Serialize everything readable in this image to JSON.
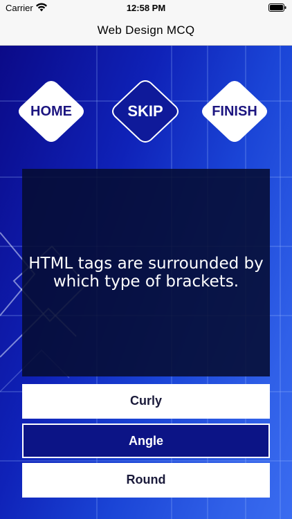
{
  "status_bar": {
    "carrier": "Carrier",
    "time": "12:58 PM",
    "wifi_icon": "wifi-icon",
    "battery_icon": "battery-icon"
  },
  "nav": {
    "title": "Web Design MCQ"
  },
  "actions": {
    "home_label": "HOME",
    "skip_label": "SKIP",
    "finish_label": "FINISH"
  },
  "question": {
    "text": "HTML tags are surrounded by which type of brackets."
  },
  "answers": [
    {
      "label": "Curly",
      "selected": false
    },
    {
      "label": "Angle",
      "selected": true
    },
    {
      "label": "Round",
      "selected": false
    }
  ],
  "colors": {
    "background_dark": "#0b0a88",
    "background_light": "#3a6cf0",
    "panel": "#060c32",
    "button_text": "#1c1580",
    "selected_answer_bg": "#0c1486"
  }
}
